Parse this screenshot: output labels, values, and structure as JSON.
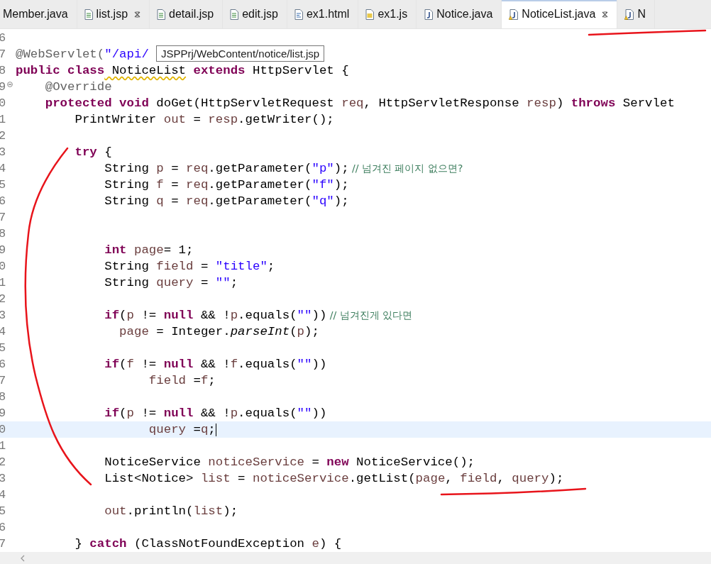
{
  "tabs": [
    {
      "label": "Member.java",
      "kind": "none",
      "closable": false,
      "selected": false
    },
    {
      "label": "list.jsp",
      "kind": "jsp",
      "closable": true,
      "selected": false
    },
    {
      "label": "detail.jsp",
      "kind": "jsp",
      "closable": false,
      "selected": false
    },
    {
      "label": "edit.jsp",
      "kind": "jsp",
      "closable": false,
      "selected": false
    },
    {
      "label": "ex1.html",
      "kind": "html",
      "closable": false,
      "selected": false
    },
    {
      "label": "ex1.js",
      "kind": "js",
      "closable": false,
      "selected": false
    },
    {
      "label": "Notice.java",
      "kind": "java",
      "closable": false,
      "selected": false
    },
    {
      "label": "NoticeList.java",
      "kind": "javawarn",
      "closable": true,
      "selected": true
    },
    {
      "label": "N",
      "kind": "javawarn",
      "closable": false,
      "selected": false
    }
  ],
  "editor": {
    "tooltip": "JSPPrj/WebContent/notice/list.jsp",
    "lines": [
      {
        "number": "6",
        "fold": false,
        "current": false
      },
      {
        "number": "7",
        "fold": false,
        "current": false,
        "tokens": [
          {
            "kind": "annotation",
            "text": "@WebServlet("
          },
          {
            "kind": "string",
            "text": "\"/api/"
          }
        ]
      },
      {
        "number": "8",
        "fold": false,
        "current": false,
        "tokens": [
          {
            "kind": "keyword",
            "text": "public class"
          },
          {
            "kind": "warn",
            "text": " NoticeList"
          },
          {
            "kind": "keyword",
            "text": " extends"
          },
          {
            "kind": "plain",
            "text": " HttpServlet {"
          }
        ]
      },
      {
        "number": "9",
        "fold": true,
        "current": false,
        "tokens": [
          {
            "kind": "annotation",
            "text": "    @Override"
          }
        ]
      },
      {
        "number": "0",
        "fold": false,
        "current": false,
        "tokens": [
          {
            "kind": "keyword",
            "text": "    protected void"
          },
          {
            "kind": "plain",
            "text": " doGet(HttpServletRequest"
          },
          {
            "kind": "var",
            "text": " req"
          },
          {
            "kind": "plain",
            "text": ", HttpServletResponse"
          },
          {
            "kind": "var",
            "text": " resp"
          },
          {
            "kind": "plain",
            "text": ")"
          },
          {
            "kind": "keyword",
            "text": " throws"
          },
          {
            "kind": "plain",
            "text": " Servlet"
          }
        ]
      },
      {
        "number": "1",
        "fold": false,
        "current": false,
        "tokens": [
          {
            "kind": "plain",
            "text": "        PrintWriter"
          },
          {
            "kind": "var",
            "text": " out"
          },
          {
            "kind": "plain",
            "text": " ="
          },
          {
            "kind": "var",
            "text": " resp"
          },
          {
            "kind": "plain",
            "text": ".getWriter();"
          }
        ]
      },
      {
        "number": "2",
        "fold": false,
        "current": false
      },
      {
        "number": "3",
        "fold": false,
        "current": false,
        "tokens": [
          {
            "kind": "keyword",
            "text": "        try"
          },
          {
            "kind": "plain",
            "text": " {"
          }
        ]
      },
      {
        "number": "4",
        "fold": false,
        "current": false,
        "tokens": [
          {
            "kind": "plain",
            "text": "            String"
          },
          {
            "kind": "var",
            "text": " p"
          },
          {
            "kind": "plain",
            "text": " ="
          },
          {
            "kind": "var",
            "text": " req"
          },
          {
            "kind": "plain",
            "text": ".getParameter("
          },
          {
            "kind": "string",
            "text": "\"p\""
          },
          {
            "kind": "plain",
            "text": ");"
          },
          {
            "kind": "comment",
            "text": " // 넘겨진 페이지 없으면?"
          }
        ]
      },
      {
        "number": "5",
        "fold": false,
        "current": false,
        "tokens": [
          {
            "kind": "plain",
            "text": "            String"
          },
          {
            "kind": "var",
            "text": " f"
          },
          {
            "kind": "plain",
            "text": " ="
          },
          {
            "kind": "var",
            "text": " req"
          },
          {
            "kind": "plain",
            "text": ".getParameter("
          },
          {
            "kind": "string",
            "text": "\"f\""
          },
          {
            "kind": "plain",
            "text": ");"
          }
        ]
      },
      {
        "number": "6",
        "fold": false,
        "current": false,
        "tokens": [
          {
            "kind": "plain",
            "text": "            String"
          },
          {
            "kind": "var",
            "text": " q"
          },
          {
            "kind": "plain",
            "text": " ="
          },
          {
            "kind": "var",
            "text": " req"
          },
          {
            "kind": "plain",
            "text": ".getParameter("
          },
          {
            "kind": "string",
            "text": "\"q\""
          },
          {
            "kind": "plain",
            "text": ");"
          }
        ]
      },
      {
        "number": "7",
        "fold": false,
        "current": false
      },
      {
        "number": "8",
        "fold": false,
        "current": false
      },
      {
        "number": "9",
        "fold": false,
        "current": false,
        "tokens": [
          {
            "kind": "keyword",
            "text": "            int"
          },
          {
            "kind": "var",
            "text": " page"
          },
          {
            "kind": "plain",
            "text": "= 1;"
          }
        ]
      },
      {
        "number": "0",
        "fold": false,
        "current": false,
        "tokens": [
          {
            "kind": "plain",
            "text": "            String"
          },
          {
            "kind": "var",
            "text": " field"
          },
          {
            "kind": "plain",
            "text": " ="
          },
          {
            "kind": "string",
            "text": " \"title\""
          },
          {
            "kind": "plain",
            "text": ";"
          }
        ]
      },
      {
        "number": "1",
        "fold": false,
        "current": false,
        "tokens": [
          {
            "kind": "plain",
            "text": "            String"
          },
          {
            "kind": "var",
            "text": " query"
          },
          {
            "kind": "plain",
            "text": " ="
          },
          {
            "kind": "string",
            "text": " \"\""
          },
          {
            "kind": "plain",
            "text": ";"
          }
        ]
      },
      {
        "number": "2",
        "fold": false,
        "current": false
      },
      {
        "number": "3",
        "fold": false,
        "current": false,
        "tokens": [
          {
            "kind": "keyword",
            "text": "            if"
          },
          {
            "kind": "plain",
            "text": "("
          },
          {
            "kind": "var",
            "text": "p"
          },
          {
            "kind": "plain",
            "text": " !="
          },
          {
            "kind": "keyword",
            "text": " null"
          },
          {
            "kind": "plain",
            "text": " && !"
          },
          {
            "kind": "var",
            "text": "p"
          },
          {
            "kind": "plain",
            "text": ".equals("
          },
          {
            "kind": "string",
            "text": "\"\""
          },
          {
            "kind": "plain",
            "text": "))"
          },
          {
            "kind": "comment",
            "text": " // 넘겨진게 있다면"
          }
        ]
      },
      {
        "number": "4",
        "fold": false,
        "current": false,
        "tokens": [
          {
            "kind": "var",
            "text": "              page"
          },
          {
            "kind": "plain",
            "text": " = Integer."
          },
          {
            "kind": "static",
            "text": "parseInt"
          },
          {
            "kind": "plain",
            "text": "("
          },
          {
            "kind": "var",
            "text": "p"
          },
          {
            "kind": "plain",
            "text": ");"
          }
        ]
      },
      {
        "number": "5",
        "fold": false,
        "current": false
      },
      {
        "number": "6",
        "fold": false,
        "current": false,
        "tokens": [
          {
            "kind": "keyword",
            "text": "            if"
          },
          {
            "kind": "plain",
            "text": "("
          },
          {
            "kind": "var",
            "text": "f"
          },
          {
            "kind": "plain",
            "text": " !="
          },
          {
            "kind": "keyword",
            "text": " null"
          },
          {
            "kind": "plain",
            "text": " && !"
          },
          {
            "kind": "var",
            "text": "f"
          },
          {
            "kind": "plain",
            "text": ".equals("
          },
          {
            "kind": "string",
            "text": "\"\""
          },
          {
            "kind": "plain",
            "text": "))"
          }
        ]
      },
      {
        "number": "7",
        "fold": false,
        "current": false,
        "tokens": [
          {
            "kind": "var",
            "text": "                  field"
          },
          {
            "kind": "plain",
            "text": " ="
          },
          {
            "kind": "var",
            "text": "f"
          },
          {
            "kind": "plain",
            "text": ";"
          }
        ]
      },
      {
        "number": "8",
        "fold": false,
        "current": false
      },
      {
        "number": "9",
        "fold": false,
        "current": false,
        "tokens": [
          {
            "kind": "keyword",
            "text": "            if"
          },
          {
            "kind": "plain",
            "text": "("
          },
          {
            "kind": "var",
            "text": "p"
          },
          {
            "kind": "plain",
            "text": " !="
          },
          {
            "kind": "keyword",
            "text": " null"
          },
          {
            "kind": "plain",
            "text": " && !"
          },
          {
            "kind": "var",
            "text": "p"
          },
          {
            "kind": "plain",
            "text": ".equals("
          },
          {
            "kind": "string",
            "text": "\"\""
          },
          {
            "kind": "plain",
            "text": "))"
          }
        ]
      },
      {
        "number": "0",
        "fold": false,
        "current": true,
        "tokens": [
          {
            "kind": "var",
            "text": "                  query"
          },
          {
            "kind": "plain",
            "text": " ="
          },
          {
            "kind": "var",
            "text": "q"
          },
          {
            "kind": "plain",
            "text": ";"
          }
        ]
      },
      {
        "number": "1",
        "fold": false,
        "current": false
      },
      {
        "number": "2",
        "fold": false,
        "current": false,
        "tokens": [
          {
            "kind": "plain",
            "text": "            NoticeService"
          },
          {
            "kind": "var",
            "text": " noticeService"
          },
          {
            "kind": "plain",
            "text": " ="
          },
          {
            "kind": "keyword",
            "text": " new"
          },
          {
            "kind": "plain",
            "text": " NoticeService();"
          }
        ]
      },
      {
        "number": "3",
        "fold": false,
        "current": false,
        "tokens": [
          {
            "kind": "plain",
            "text": "            List<Notice>"
          },
          {
            "kind": "var",
            "text": " list"
          },
          {
            "kind": "plain",
            "text": " ="
          },
          {
            "kind": "var",
            "text": " noticeService"
          },
          {
            "kind": "plain",
            "text": ".getList("
          },
          {
            "kind": "var",
            "text": "page"
          },
          {
            "kind": "plain",
            "text": ","
          },
          {
            "kind": "var",
            "text": " field"
          },
          {
            "kind": "plain",
            "text": ","
          },
          {
            "kind": "var",
            "text": " query"
          },
          {
            "kind": "plain",
            "text": ");"
          }
        ]
      },
      {
        "number": "4",
        "fold": false,
        "current": false
      },
      {
        "number": "5",
        "fold": false,
        "current": false,
        "tokens": [
          {
            "kind": "var",
            "text": "            out"
          },
          {
            "kind": "plain",
            "text": ".println("
          },
          {
            "kind": "var",
            "text": "list"
          },
          {
            "kind": "plain",
            "text": ");"
          }
        ]
      },
      {
        "number": "6",
        "fold": false,
        "current": false
      },
      {
        "number": "7",
        "fold": false,
        "current": false,
        "tokens": [
          {
            "kind": "plain",
            "text": "        }"
          },
          {
            "kind": "keyword",
            "text": " catch"
          },
          {
            "kind": "plain",
            "text": " (ClassNotFoundException"
          },
          {
            "kind": "var",
            "text": " e"
          },
          {
            "kind": "plain",
            "text": ") {"
          }
        ]
      }
    ]
  }
}
